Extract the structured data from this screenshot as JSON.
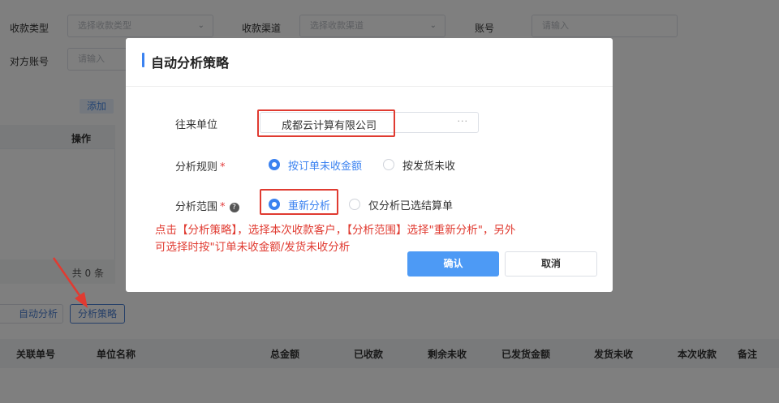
{
  "filters": {
    "row1": [
      {
        "label": "收款类型",
        "placeholder": "选择收款类型"
      },
      {
        "label": "收款渠道",
        "placeholder": "选择收款渠道"
      },
      {
        "label": "账号",
        "placeholder": "请输入"
      }
    ],
    "row2": {
      "label": "对方账号",
      "placeholder": "请输入"
    }
  },
  "left_panel": {
    "add_button": "添加",
    "header": "操作",
    "footer": "共 0 条"
  },
  "actions": {
    "auto_analyze": "自动分析",
    "analysis_strategy": "分析策略"
  },
  "table_columns": [
    "关联单号",
    "单位名称",
    "总金额",
    "已收款",
    "剩余未收",
    "已发货金额",
    "发货未收",
    "本次收款",
    "备注"
  ],
  "dialog": {
    "title": "自动分析策略",
    "unit_label": "往来单位",
    "unit_value": "成都云计算有限公司",
    "unit_dots": "···",
    "rule_label": "分析规则",
    "rule_required": "*",
    "rule_options": [
      "按订单未收金额",
      "按发货未收"
    ],
    "rule_selected": 0,
    "scope_label": "分析范围",
    "scope_required": "*",
    "scope_help": "?",
    "scope_options": [
      "重新分析",
      "仅分析已选结算单"
    ],
    "scope_selected": 0,
    "annotation_line1": "点击【分析策略】，选择本次收款客户，【分析范围】选择\"重新分析\"，另外",
    "annotation_line2": "可选择时按\"订单未收金额/发货未收分析",
    "confirm": "确认",
    "cancel": "取消"
  },
  "colors": {
    "primary": "#3b82f0",
    "confirm": "#4d9af5",
    "annotation": "#e03b31",
    "overlay": "rgba(0,0,0,0.5)"
  }
}
